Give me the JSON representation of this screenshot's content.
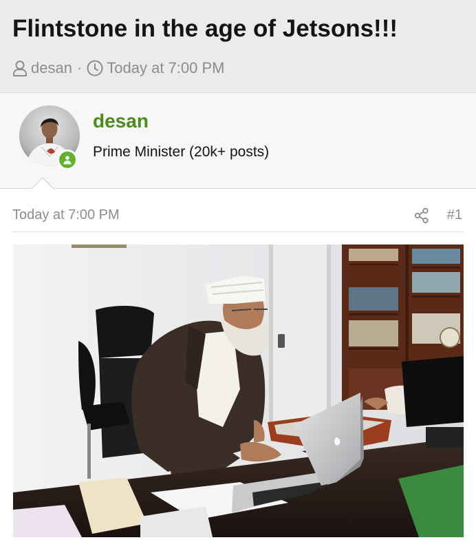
{
  "thread": {
    "title": "Flintstone in the age of Jetsons!!!",
    "author": "desan",
    "separator": "·",
    "date": "Today at 7:00 PM"
  },
  "user": {
    "name": "desan",
    "title": "Prime Minister (20k+ posts)",
    "status": "online"
  },
  "post": {
    "date": "Today at 7:00 PM",
    "number": "#1"
  },
  "colors": {
    "header_bg": "#ebebeb",
    "username": "#4a8c19",
    "online": "#63b12d",
    "muted_text": "#8c8c8c"
  },
  "icons": {
    "author": "user-icon",
    "date": "clock-icon",
    "share": "share-icon",
    "status": "user-online-icon"
  }
}
